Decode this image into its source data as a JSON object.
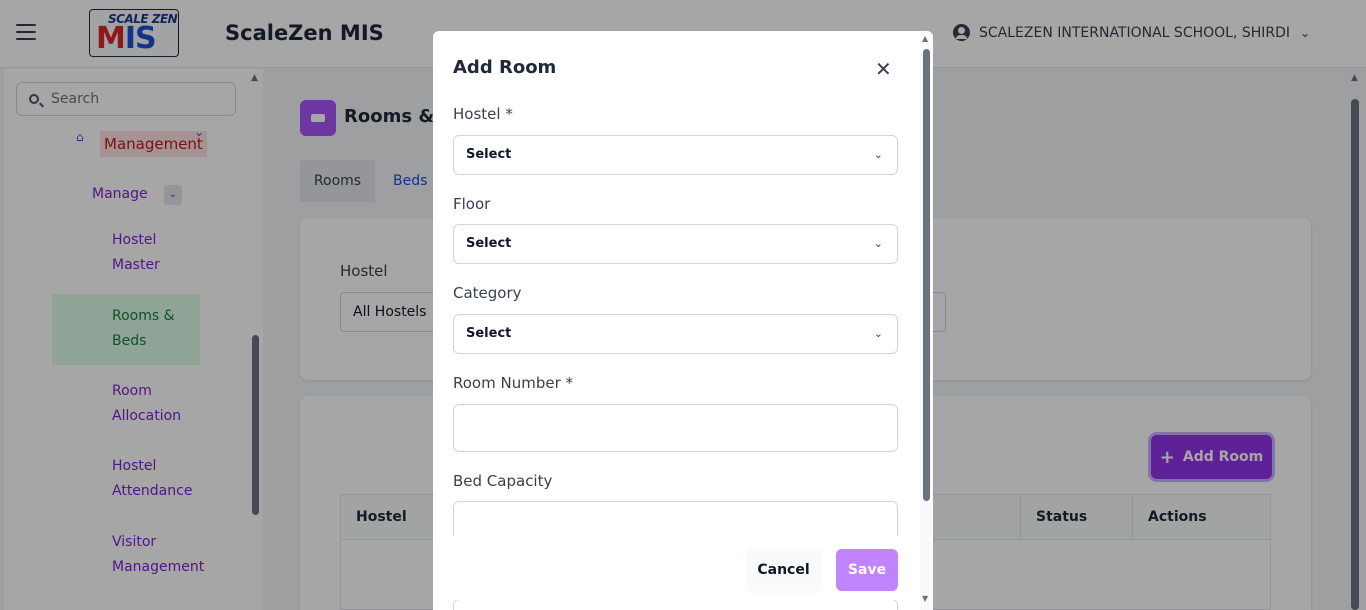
{
  "header": {
    "logo_top": "SCALE ZEN",
    "logo_main_a": "M",
    "logo_main_b": "IS",
    "app_title": "ScaleZen MIS",
    "school_name": "SCALEZEN INTERNATIONAL SCHOOL, SHIRDI"
  },
  "sidebar": {
    "search_placeholder": "Search",
    "section_label": "Management",
    "group_label": "Manage",
    "items": [
      {
        "label": "Hostel Master"
      },
      {
        "label": "Rooms & Beds"
      },
      {
        "label": "Room Allocation"
      },
      {
        "label": "Hostel Attendance"
      },
      {
        "label": "Visitor Management"
      }
    ]
  },
  "main": {
    "page_title": "Rooms & B",
    "tabs": [
      {
        "label": "Rooms"
      },
      {
        "label": "Beds"
      }
    ],
    "filter": {
      "label": "Hostel",
      "value": "All Hostels"
    },
    "add_button": "Add Room",
    "table_headers": [
      "Hostel",
      "y",
      "Status",
      "Actions"
    ]
  },
  "modal": {
    "title": "Add Room",
    "fields": [
      {
        "label": "Hostel *",
        "value": "Select"
      },
      {
        "label": "Floor",
        "value": "Select"
      },
      {
        "label": "Category",
        "value": "Select"
      },
      {
        "label": "Room Number *",
        "value": ""
      },
      {
        "label": "Bed Capacity",
        "value": ""
      }
    ],
    "cancel_label": "Cancel",
    "save_label": "Save"
  },
  "colors": {
    "accent": "#9333ea",
    "save_button": "#c084fc",
    "active_item": "#15803d",
    "overlay": "rgba(0,0,0,0.35)"
  },
  "icons": [
    "menu-icon",
    "user-circle-icon",
    "chevron-down-icon",
    "search-icon",
    "home-icon",
    "bed-icon",
    "plus-icon",
    "close-icon"
  ]
}
